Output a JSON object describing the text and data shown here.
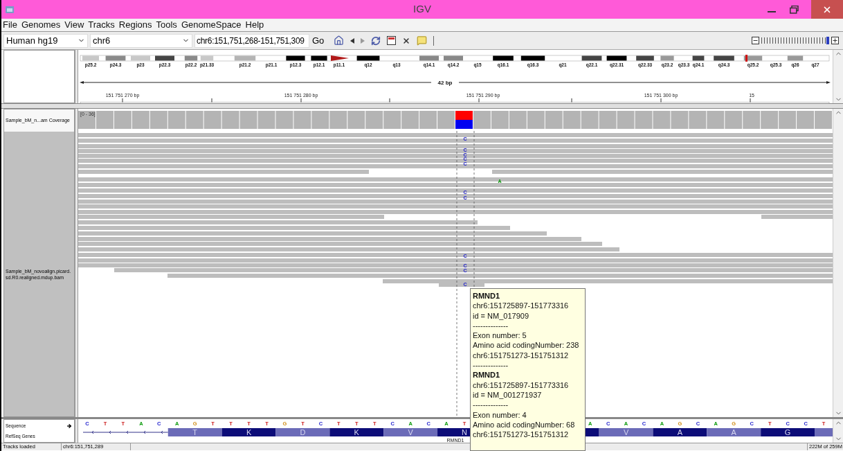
{
  "window": {
    "title": "IGV"
  },
  "menu": [
    "File",
    "Genomes",
    "View",
    "Tracks",
    "Regions",
    "Tools",
    "GenomeSpace",
    "Help"
  ],
  "toolbar": {
    "genome": "Human hg19",
    "chromosome": "chr6",
    "locus": "chr6:151,751,268-151,751,309",
    "go": "Go",
    "zoom": {
      "level": 1
    }
  },
  "cytoband": {
    "bands": [
      "p25.2",
      "p24.3",
      "p23",
      "p22.3",
      "p22.2",
      "p21.33",
      "p21.2",
      "p21.1",
      "p12.3",
      "p12.1",
      "p11.1",
      "q12",
      "q13",
      "q14.1",
      "q14.2",
      "q15",
      "q16.1",
      "q16.3",
      "q21",
      "q22.1",
      "q22.31",
      "q22.33",
      "q23.2",
      "q23.3",
      "q24.1",
      "q24.3",
      "q25.2",
      "q25.3",
      "q26",
      "q27"
    ]
  },
  "ruler": {
    "span": "42 bp",
    "ticks": [
      "151 751 270 bp",
      "151 751 280 bp",
      "151 751 290 bp",
      "151 751 300 bp",
      "15"
    ]
  },
  "coverage": {
    "name": "Sample_bM_n...am Coverage",
    "range": "[0 - 36]"
  },
  "alignments": {
    "name": "Sample_bM_novoalign.picard.sd.R0.realigned.mdup.bam",
    "mismatches": [
      {
        "base": "C"
      },
      {
        "base": "C"
      },
      {
        "base": "C"
      },
      {
        "base": "C"
      },
      {
        "base": "C"
      },
      {
        "base": "A"
      },
      {
        "base": "C"
      },
      {
        "base": "C"
      },
      {
        "base": "C"
      },
      {
        "base": "C"
      },
      {
        "base": "C"
      },
      {
        "base": "C"
      }
    ]
  },
  "sequence": {
    "name": "Sequence",
    "bases_left": [
      "C",
      "T",
      "T",
      "A",
      "C",
      "A",
      "G",
      "T",
      "T",
      "T",
      "T",
      "G",
      "T",
      "C",
      "T",
      "T",
      "T",
      "C",
      "A",
      "C",
      "A",
      "T"
    ],
    "bases_right": [
      "A",
      "C",
      "A",
      "C",
      "A",
      "G",
      "C",
      "A",
      "G",
      "C",
      "T",
      "C",
      "C",
      "T"
    ]
  },
  "refseq": {
    "name": "RefSeq Genes",
    "amino_acids_left": [
      "T",
      "K",
      "D",
      "K",
      "V",
      "N"
    ],
    "amino_acids_right": [
      "V",
      "A",
      "A",
      "G"
    ],
    "gene": "RMND1"
  },
  "tooltip": {
    "lines": [
      {
        "kind": "title",
        "text": "RMND1"
      },
      {
        "kind": "text",
        "text": "chr6:151725897-151773316"
      },
      {
        "kind": "text",
        "text": "id = NM_017909"
      },
      {
        "kind": "text",
        "text": "--------------"
      },
      {
        "kind": "text",
        "text": "Exon number: 5"
      },
      {
        "kind": "text",
        "text": "Amino acid codingNumber: 238"
      },
      {
        "kind": "text",
        "text": "chr6:151751273-151751312"
      },
      {
        "kind": "text",
        "text": "--------------"
      },
      {
        "kind": "title",
        "text": "RMND1"
      },
      {
        "kind": "text",
        "text": "chr6:151725897-151773316"
      },
      {
        "kind": "text",
        "text": "id = NM_001271937"
      },
      {
        "kind": "text",
        "text": "--------------"
      },
      {
        "kind": "text",
        "text": "Exon number: 4"
      },
      {
        "kind": "text",
        "text": "Amino acid codingNumber: 68"
      },
      {
        "kind": "text",
        "text": "chr6:151751273-151751312"
      }
    ]
  },
  "status_bar": [
    "Tracks loaded",
    "chr6:151,751,289",
    "222M of 259M"
  ]
}
